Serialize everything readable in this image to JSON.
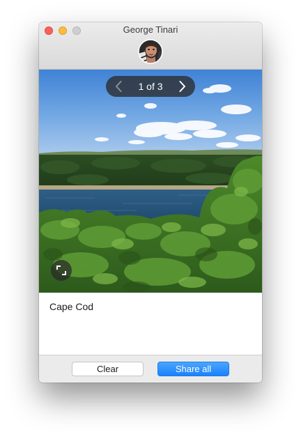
{
  "window": {
    "title": "George Tinari"
  },
  "pager": {
    "position_text": "1 of 3",
    "current": 1,
    "total": 3
  },
  "photo": {
    "caption": "Cape Cod"
  },
  "actions": {
    "clear_label": "Clear",
    "share_label": "Share all"
  },
  "icons": {
    "prev": "chevron-left-icon",
    "next": "chevron-right-icon",
    "expand": "expand-icon"
  },
  "colors": {
    "close": "#fc605c",
    "minimize": "#fdbc40",
    "zoom": "#cfcfcf",
    "accent": "#1a82fb"
  }
}
